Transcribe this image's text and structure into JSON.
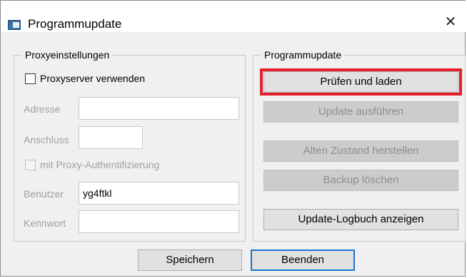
{
  "window": {
    "title": "Programmupdate",
    "close_symbol": "✕"
  },
  "proxy": {
    "legend": "Proxyeinstellungen",
    "use_proxy_label": "Proxyserver verwenden",
    "use_proxy_checked": false,
    "address_label": "Adresse",
    "address_value": "",
    "port_label": "Anschluss",
    "port_value": "",
    "auth_label": "mit Proxy-Authentifizierung",
    "auth_checked": false,
    "user_label": "Benutzer",
    "user_value": "yg4ftkl",
    "password_label": "Kennwort",
    "password_value": ""
  },
  "update": {
    "legend": "Programmupdate",
    "check_load_label": "Prüfen und laden",
    "run_update_label": "Update ausführen",
    "restore_label": "Alten Zustand herstellen",
    "delete_backup_label": "Backup löschen",
    "show_log_label": "Update-Logbuch anzeigen",
    "highlight_color": "#e5202a"
  },
  "footer": {
    "save_label": "Speichern",
    "exit_label": "Beenden"
  },
  "icons": {
    "title_icon": "window-app-icon",
    "close_icon": "close-icon"
  }
}
